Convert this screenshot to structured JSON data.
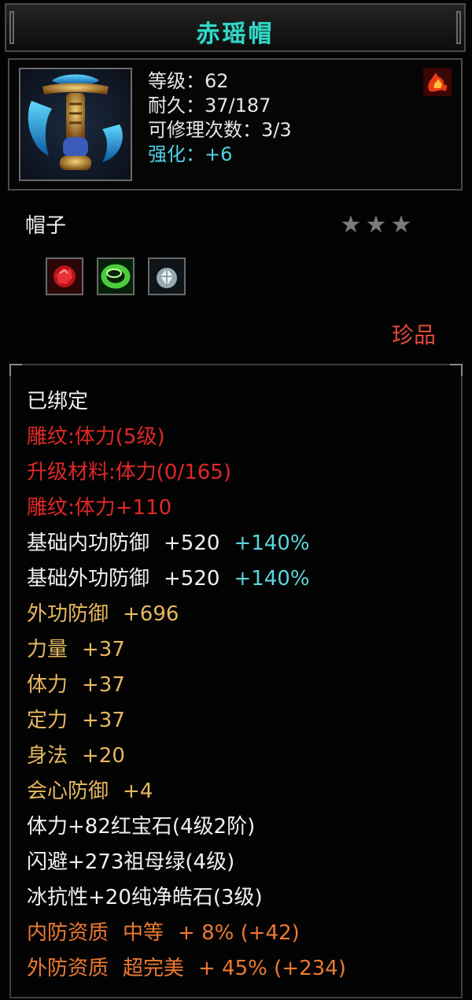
{
  "item": {
    "title": "赤瑶帽",
    "type": "帽子",
    "rarity": "珍品",
    "stars": 3
  },
  "stats": {
    "level": "等级：62",
    "durability": "耐久：37/187",
    "repairs": "可修理次数：3/3",
    "enhance": "强化：+6"
  },
  "gems": [
    {
      "name": "ruby-gem-icon"
    },
    {
      "name": "emerald-gem-icon"
    },
    {
      "name": "diamond-gem-icon"
    }
  ],
  "attributes": {
    "bound": "已绑定",
    "engrave": "雕纹:体力(5级)",
    "upgrade_material": "升级材料:体力(0/165)",
    "engrave_bonus": "雕纹:体力+110",
    "base_inner_def": {
      "label": "基础内功防御",
      "value": "+520",
      "pct": "+140%"
    },
    "base_outer_def": {
      "label": "基础外功防御",
      "value": "+520",
      "pct": "+140%"
    },
    "outer_def": {
      "label": "外功防御",
      "value": "+696"
    },
    "strength": {
      "label": "力量",
      "value": "+37"
    },
    "stamina": {
      "label": "体力",
      "value": "+37"
    },
    "focus": {
      "label": "定力",
      "value": "+37"
    },
    "agility": {
      "label": "身法",
      "value": "+20"
    },
    "crit_def": {
      "label": "会心防御",
      "value": "+4"
    },
    "gem1": "体力+82红宝石(4级2阶)",
    "gem2": "闪避+273祖母绿(4级)",
    "gem3": "冰抗性+20纯净皓石(3级)",
    "inner_quality": {
      "label": "内防资质",
      "grade": "中等",
      "value": "+ 8% (+42)"
    },
    "outer_quality": {
      "label": "外防资质",
      "grade": "超完美",
      "value": "+ 45% (+234)"
    }
  },
  "colors": {
    "title": "#36d6c6",
    "enhance": "#4fd2e6",
    "red": "#e02828",
    "gold": "#e6b860",
    "orange": "#ec7a30",
    "cyan": "#5ad6dc",
    "rarity": "#e04a3a"
  }
}
